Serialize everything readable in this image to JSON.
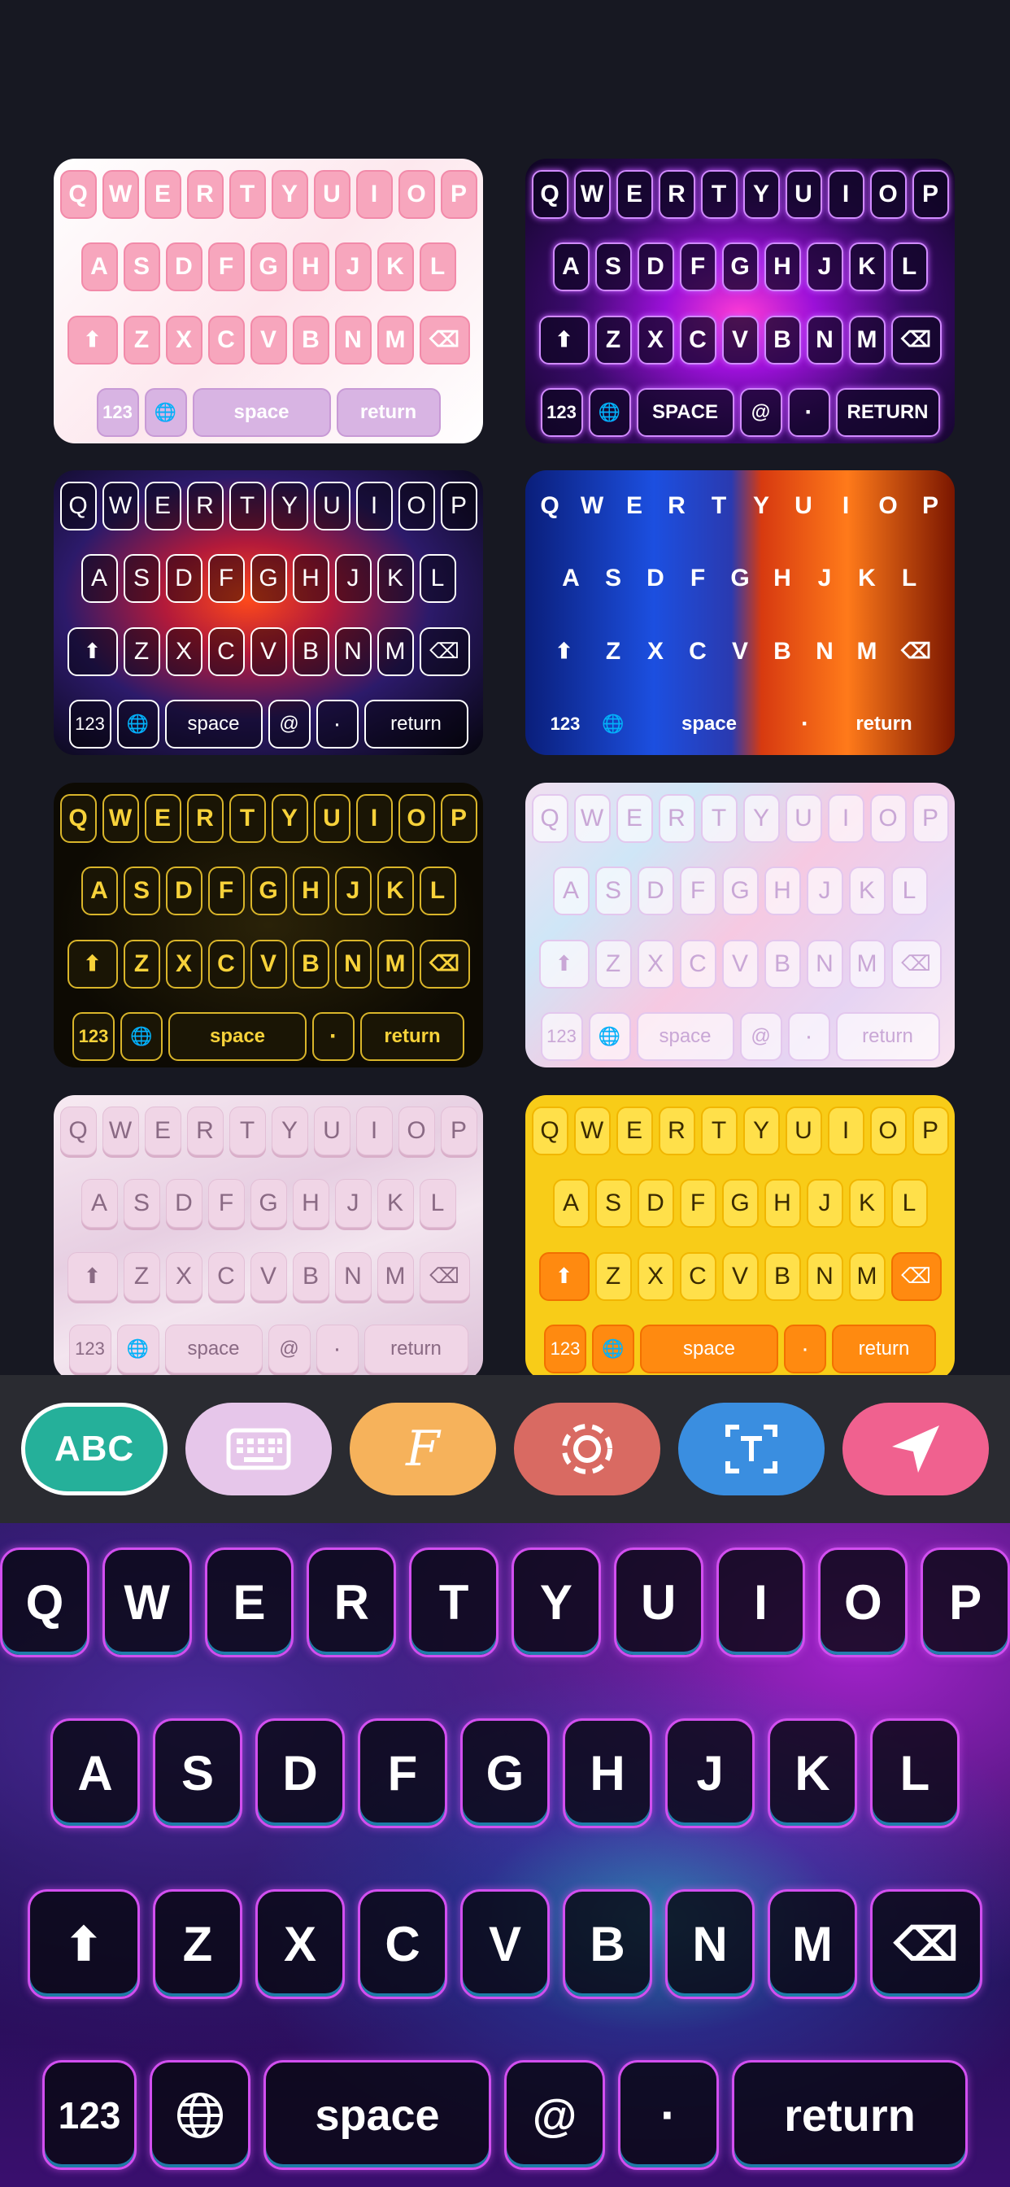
{
  "themes": [
    {
      "row1": [
        "Q",
        "W",
        "E",
        "R",
        "T",
        "Y",
        "U",
        "I",
        "O",
        "P"
      ],
      "row2": [
        "A",
        "S",
        "D",
        "F",
        "G",
        "H",
        "J",
        "K",
        "L"
      ],
      "row3": [
        "Z",
        "X",
        "C",
        "V",
        "B",
        "N",
        "M"
      ],
      "bottom": [
        "123",
        "space",
        "return"
      ]
    },
    {
      "row1": [
        "Q",
        "W",
        "E",
        "R",
        "T",
        "Y",
        "U",
        "I",
        "O",
        "P"
      ],
      "row2": [
        "A",
        "S",
        "D",
        "F",
        "G",
        "H",
        "J",
        "K",
        "L"
      ],
      "row3": [
        "Z",
        "X",
        "C",
        "V",
        "B",
        "N",
        "M"
      ],
      "bottom": [
        "123",
        "SPACE",
        "@",
        "·",
        "RETURN"
      ]
    },
    {
      "row1": [
        "Q",
        "W",
        "E",
        "R",
        "T",
        "Y",
        "U",
        "I",
        "O",
        "P"
      ],
      "row2": [
        "A",
        "S",
        "D",
        "F",
        "G",
        "H",
        "J",
        "K",
        "L"
      ],
      "row3": [
        "Z",
        "X",
        "C",
        "V",
        "B",
        "N",
        "M"
      ],
      "bottom": [
        "123",
        "space",
        "@",
        "·",
        "return"
      ]
    },
    {
      "row1": [
        "Q",
        "W",
        "E",
        "R",
        "T",
        "Y",
        "U",
        "I",
        "O",
        "P"
      ],
      "row2": [
        "A",
        "S",
        "D",
        "F",
        "G",
        "H",
        "J",
        "K",
        "L"
      ],
      "row3": [
        "Z",
        "X",
        "C",
        "V",
        "B",
        "N",
        "M"
      ],
      "bottom": [
        "123",
        "space",
        "·",
        "return"
      ]
    },
    {
      "row1": [
        "Q",
        "W",
        "E",
        "R",
        "T",
        "Y",
        "U",
        "I",
        "O",
        "P"
      ],
      "row2": [
        "A",
        "S",
        "D",
        "F",
        "G",
        "H",
        "J",
        "K",
        "L"
      ],
      "row3": [
        "Z",
        "X",
        "C",
        "V",
        "B",
        "N",
        "M"
      ],
      "bottom": [
        "123",
        "space",
        "·",
        "return"
      ]
    },
    {
      "row1": [
        "Q",
        "W",
        "E",
        "R",
        "T",
        "Y",
        "U",
        "I",
        "O",
        "P"
      ],
      "row2": [
        "A",
        "S",
        "D",
        "F",
        "G",
        "H",
        "J",
        "K",
        "L"
      ],
      "row3": [
        "Z",
        "X",
        "C",
        "V",
        "B",
        "N",
        "M"
      ],
      "bottom": [
        "123",
        "space",
        "@",
        "·",
        "return"
      ]
    },
    {
      "row1": [
        "Q",
        "W",
        "E",
        "R",
        "T",
        "Y",
        "U",
        "I",
        "O",
        "P"
      ],
      "row2": [
        "A",
        "S",
        "D",
        "F",
        "G",
        "H",
        "J",
        "K",
        "L"
      ],
      "row3": [
        "Z",
        "X",
        "C",
        "V",
        "B",
        "N",
        "M"
      ],
      "bottom": [
        "123",
        "space",
        "@",
        "·",
        "return"
      ]
    },
    {
      "row1": [
        "Q",
        "W",
        "E",
        "R",
        "T",
        "Y",
        "U",
        "I",
        "O",
        "P"
      ],
      "row2": [
        "A",
        "S",
        "D",
        "F",
        "G",
        "H",
        "J",
        "K",
        "L"
      ],
      "row3": [
        "Z",
        "X",
        "C",
        "V",
        "B",
        "N",
        "M"
      ],
      "bottom": [
        "123",
        "space",
        "·",
        "return"
      ]
    }
  ],
  "toolbar": {
    "abc_label": "ABC",
    "font_label": "F",
    "icons": [
      "keyboard-icon",
      "font-icon",
      "effect-icon",
      "text-icon",
      "send-icon"
    ]
  },
  "keyboard": {
    "row1": [
      "Q",
      "W",
      "E",
      "R",
      "T",
      "Y",
      "U",
      "I",
      "O",
      "P"
    ],
    "row2": [
      "A",
      "S",
      "D",
      "F",
      "G",
      "H",
      "J",
      "K",
      "L"
    ],
    "row3": [
      "Z",
      "X",
      "C",
      "V",
      "B",
      "N",
      "M"
    ],
    "num_label": "123",
    "space_label": "space",
    "at_label": "@",
    "dot_label": "·",
    "return_label": "return"
  }
}
